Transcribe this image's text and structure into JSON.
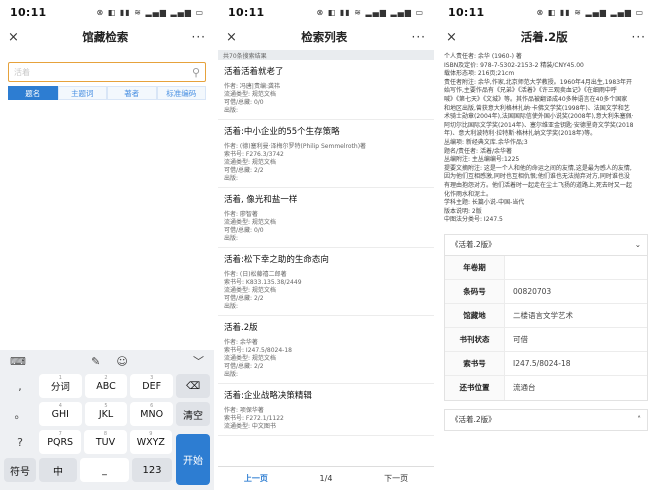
{
  "panels": {
    "search": {
      "status_time": "10:11",
      "title": "馆藏检索",
      "close": "×",
      "more": "···",
      "search_value": "活着",
      "filters": [
        "题名",
        "主题词",
        "著者",
        "标准编码"
      ],
      "keyboard": {
        "top_left": "⌨",
        "top_mid": [
          "✎",
          "☺"
        ],
        "top_right": "﹀",
        "rows": [
          [
            {
              "sup": "1",
              "label": "分词"
            },
            {
              "sup": "2",
              "label": "ABC"
            },
            {
              "sup": "3",
              "label": "DEF"
            }
          ],
          [
            {
              "sup": "4",
              "label": "GHI"
            },
            {
              "sup": "5",
              "label": "JKL"
            },
            {
              "sup": "6",
              "label": "MNO"
            }
          ],
          [
            {
              "sup": "7",
              "label": "PQRS"
            },
            {
              "sup": "8",
              "label": "TUV"
            },
            {
              "sup": "9",
              "label": "WXYZ"
            }
          ]
        ],
        "side": [
          ",",
          "。",
          "?",
          "!"
        ],
        "delete": "⌫",
        "clear": "清空",
        "symbol": "符号",
        "lang": "中",
        "space": "_",
        "num": "123",
        "go": "开始"
      }
    },
    "list": {
      "status_time": "10:11",
      "title": "检索列表",
      "close": "×",
      "more": "···",
      "count": "共70条搜索结果",
      "books": [
        {
          "title": "活着活着就老了",
          "lines": [
            "作者: 冯唐|责编:龚祎",
            "流通类型: 规范文档",
            "可借/总藏: 0/0",
            "出版:"
          ]
        },
        {
          "title": "活着:中小企业的55个生存策略",
          "lines": [
            "作者: (德)塞利曼·泽梅尔罗特(Philip Semmelroth)著",
            "索书号: F276.3/3742",
            "流通类型: 规范文档",
            "可借/总藏: 2/2",
            "出版:"
          ]
        },
        {
          "title": "活着, 像光和盐一样",
          "lines": [
            "作者: 廖智著",
            "流通类型: 规范文档",
            "可借/总藏: 0/0",
            "出版:"
          ]
        },
        {
          "title": "活着:松下幸之助的生命态向",
          "lines": [
            "作者: (日)松藤禧二郎著",
            "索书号: K833.135.38/2449",
            "流通类型: 规范文档",
            "可借/总藏: 2/2",
            "出版:"
          ]
        },
        {
          "title": "活着.2版",
          "lines": [
            "作者: 余华著",
            "索书号: I247.5/8024-18",
            "流通类型: 规范文档",
            "可借/总藏: 2/2",
            "出版:"
          ]
        },
        {
          "title": "活着:企业战略决策精辑",
          "lines": [
            "作者: 项保华著",
            "索书号: F272.1/1122",
            "流通类型: 中文图书"
          ]
        }
      ],
      "pager": {
        "prev": "上一页",
        "page": "1/4",
        "next": "下一页"
      }
    },
    "detail": {
      "status_time": "10:11",
      "title": "活着.2版",
      "close": "×",
      "more": "···",
      "info": [
        "个人责任者: 余华 (1960-) 著",
        "ISBN及定价: 978-7-5302-2153-2 精装/CNY45.00",
        "载体形态项: 216页;21cm",
        "责任者附注: 余华,作家,北京师范大学教授。1960年4月出生,1983年开",
        "始写作,主要作品有《兄弟》《活着》《许三观卖血记》《在细雨中呼",
        "喊》《第七天》《文城》等。其作品被翻译成40多种语言在40多个国家",
        "和地区出版,曾获意大利格林扎纳·卡佛文学奖(1998年)、法国文学和艺",
        "术骑士勋章(2004年),法国国际信使外国小说奖(2008年),意大利朱塞佩·",
        "阿切尔比国际文学奖(2014年)、塞尔维亚金钥匙·安德里奇文学奖(2018",
        "年)、意大利波特利·拉特斯·格林扎纳文学奖(2018年)等。",
        "丛编项: 新经典文库.余华作品;3",
        "题名/责任者: 活着/余华著",
        "丛编附注: 主丛编编号:1225",
        "提要文摘附注: 这是一个人和他的命运之间的友情,这是最为感人的友情,",
        "因为他们互相感激,同时也互相仇恨;他们谁也无法抛弃对方,同时谁也没",
        "有理由抱怨对方。他们活着时一起走在尘土飞扬的道路上,死去时又一起",
        "化作雨水和泥土。",
        "学科主题: 长篇小说-中国-当代",
        "版本说明: 2版",
        "中图法分类号: I247.5"
      ],
      "section1": "《活着.2版》",
      "holdings": [
        {
          "k": "年卷期",
          "v": ""
        },
        {
          "k": "条码号",
          "v": "00820703"
        },
        {
          "k": "馆藏地",
          "v": "二楼语言文学艺术"
        },
        {
          "k": "书刊状态",
          "v": "可借"
        },
        {
          "k": "索书号",
          "v": "I247.5/8024-18"
        },
        {
          "k": "还书位置",
          "v": "流通台"
        }
      ],
      "section2": "《活着.2版》",
      "chevron_down": "⌄",
      "chevron_up": "˄"
    },
    "status_icons": "⊗ ◧ ▮▮ ≋ ▂▄▆ ▂▄▆ ▭"
  }
}
